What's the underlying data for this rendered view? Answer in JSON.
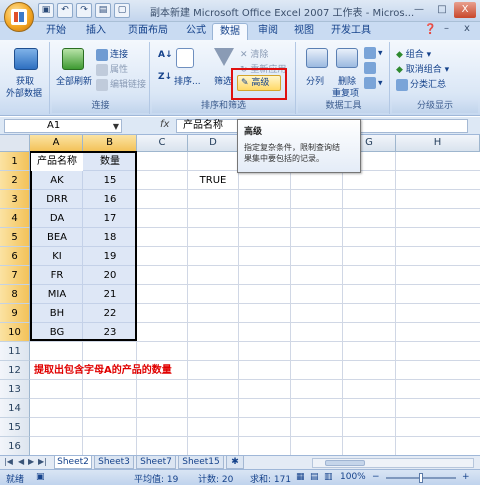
{
  "title_bar": {
    "title": "副本新建 Microsoft Office Excel 2007 工作表 - Micros...",
    "qat_icons": [
      "save-icon",
      "undo-icon",
      "redo-icon",
      "print-preview-icon",
      "open-icon"
    ],
    "minimize": "—",
    "maximize": "□",
    "close": "X"
  },
  "tabs": [
    {
      "label": "开始"
    },
    {
      "label": "插入"
    },
    {
      "label": "页面布局"
    },
    {
      "label": "公式"
    },
    {
      "label": "数据",
      "active": true
    },
    {
      "label": "审阅"
    },
    {
      "label": "视图"
    },
    {
      "label": "开发工具"
    }
  ],
  "ribbon": {
    "groups": {
      "connections": "连接",
      "sort_filter": "排序和筛选",
      "data_tools": "数据工具",
      "outline": "分级显示"
    },
    "get_external_line1": "获取",
    "get_external_line2": "外部数据",
    "refresh_all": "全部刷新",
    "connections": "连接",
    "properties": "属性",
    "edit_links": "编辑链接",
    "sort": "排序...",
    "filter": "筛选",
    "clear": "清除",
    "reapply": "重新应用",
    "advanced": "高级",
    "text_to_columns": "分列",
    "remove_dup_line1": "删除",
    "remove_dup_line2": "重复项",
    "group": "组合",
    "ungroup": "取消组合",
    "subtotal": "分类汇总"
  },
  "formula_bar": {
    "name_box": "A1",
    "fx": "fx",
    "content": "产品名称"
  },
  "tooltip": {
    "title": "高级",
    "body_line1": "指定复杂条件，限制查询结",
    "body_line2": "果集中要包括的记录。"
  },
  "grid": {
    "columns": [
      "A",
      "B",
      "C",
      "D",
      "E",
      "F",
      "G",
      "H"
    ],
    "rows": [
      "1",
      "2",
      "3",
      "4",
      "5",
      "6",
      "7",
      "8",
      "9",
      "10",
      "11",
      "12",
      "13",
      "14",
      "15",
      "16"
    ],
    "header": {
      "a": "产品名称",
      "b": "数量"
    },
    "data": [
      {
        "a": "AK",
        "b": "15"
      },
      {
        "a": "DRR",
        "b": "16"
      },
      {
        "a": "DA",
        "b": "17"
      },
      {
        "a": "BEA",
        "b": "18"
      },
      {
        "a": "KI",
        "b": "19"
      },
      {
        "a": "FR",
        "b": "20"
      },
      {
        "a": "MIA",
        "b": "21"
      },
      {
        "a": "BH",
        "b": "22"
      },
      {
        "a": "BG",
        "b": "23"
      }
    ],
    "d2": "TRUE",
    "note": "提取出包含字母A的产品的数量"
  },
  "sheets": [
    {
      "label": "Sheet2",
      "active": true
    },
    {
      "label": "Sheet3"
    },
    {
      "label": "Sheet7"
    },
    {
      "label": "Sheet15"
    }
  ],
  "status": {
    "ready": "就绪",
    "average": "平均值: 19",
    "count": "计数: 20",
    "sum": "求和: 171",
    "zoom": "100%",
    "zoom_minus": "−",
    "zoom_plus": "+"
  }
}
